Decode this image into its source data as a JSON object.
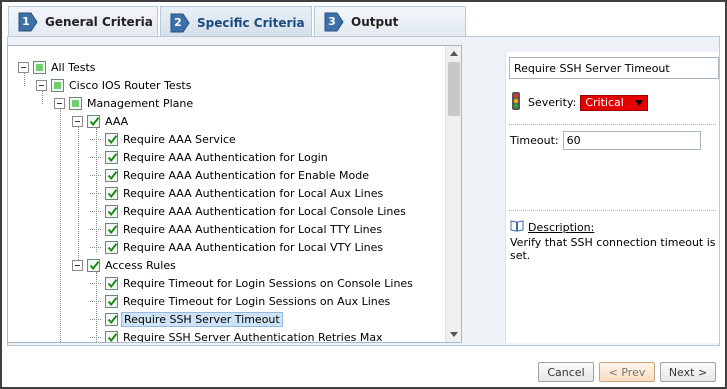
{
  "tabs": [
    {
      "number": "1",
      "label": "General Criteria"
    },
    {
      "number": "2",
      "label": "Specific Criteria"
    },
    {
      "number": "3",
      "label": "Output"
    }
  ],
  "tree": {
    "rows": [
      {
        "label": "All Tests",
        "state": "partial"
      },
      {
        "label": "Cisco IOS Router Tests",
        "state": "partial"
      },
      {
        "label": "Management Plane",
        "state": "partial"
      },
      {
        "label": "AAA",
        "state": "checked"
      },
      {
        "label": "Require AAA Service",
        "state": "checked"
      },
      {
        "label": "Require AAA Authentication for Login",
        "state": "checked"
      },
      {
        "label": "Require AAA Authentication for Enable Mode",
        "state": "checked"
      },
      {
        "label": "Require AAA Authentication for Local Aux Lines",
        "state": "checked"
      },
      {
        "label": "Require AAA Authentication for Local Console Lines",
        "state": "checked"
      },
      {
        "label": "Require AAA Authentication for Local TTY Lines",
        "state": "checked"
      },
      {
        "label": "Require AAA Authentication for Local VTY Lines",
        "state": "checked"
      },
      {
        "label": "Access Rules",
        "state": "checked"
      },
      {
        "label": "Require Timeout for Login Sessions on Console Lines",
        "state": "checked"
      },
      {
        "label": "Require Timeout for Login Sessions on Aux Lines",
        "state": "checked"
      },
      {
        "label": "Require SSH Server Timeout",
        "state": "checked",
        "selected": true
      },
      {
        "label": "Require SSH Server Authentication Retries Max",
        "state": "checked"
      }
    ]
  },
  "detail": {
    "test_name": "Require SSH Server Timeout",
    "severity_label": "Severity:",
    "severity_value": "Critical",
    "severity_color": "#e50000",
    "timeout_label": "Timeout:",
    "timeout_value": "60",
    "description_title": "Description:",
    "description_text": "Verify that SSH connection timeout is set.",
    "severity_icon": "traffic-light-icon",
    "description_icon": "book-icon"
  },
  "buttons": {
    "cancel": "Cancel",
    "prev": "< Prev",
    "next": "Next >"
  }
}
